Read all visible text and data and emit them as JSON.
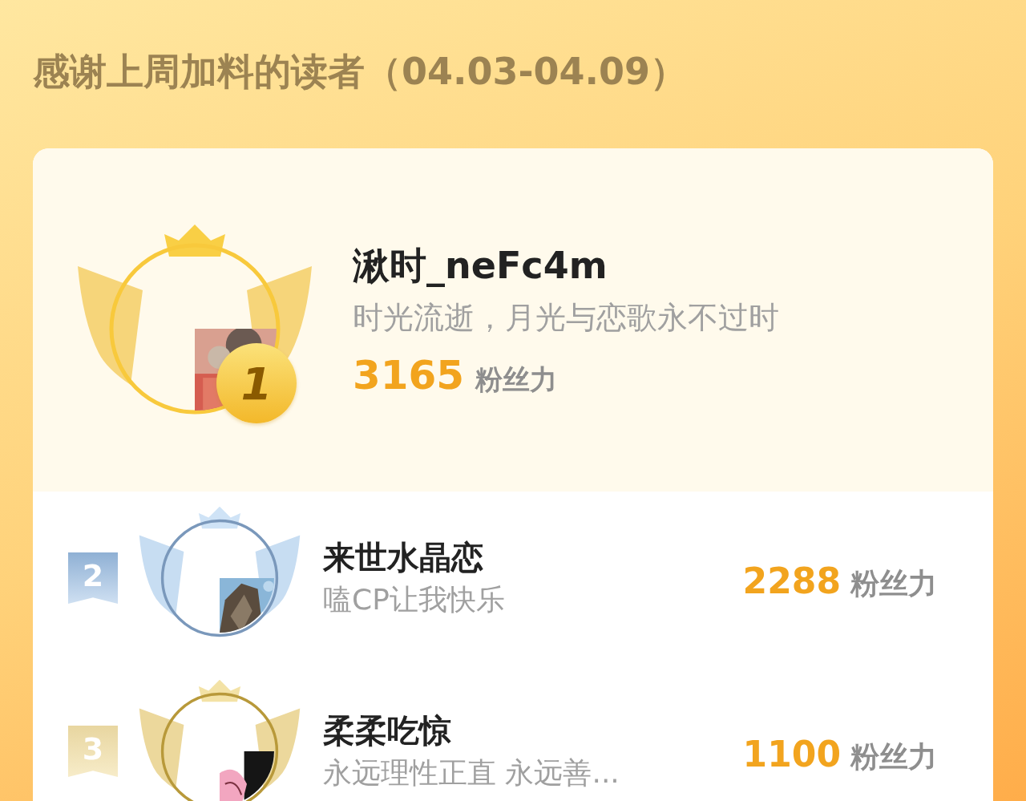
{
  "title": "感谢上周加料的读者（04.03-04.09）",
  "top": {
    "rank": "1",
    "kind": "gold",
    "name": "湫时_neFc4m",
    "motto": "时光流逝，月光与恋歌永不过时",
    "score": "3165",
    "unit": "粉丝力"
  },
  "rows": [
    {
      "rank": "2",
      "kind": "silver",
      "name": "来世水晶恋",
      "motto": "嗑CP让我快乐",
      "score": "2288",
      "unit": "粉丝力"
    },
    {
      "rank": "3",
      "kind": "bronze",
      "name": "柔柔吃惊",
      "motto": "永远理性正直 永远善...",
      "score": "1100",
      "unit": "粉丝力"
    }
  ]
}
